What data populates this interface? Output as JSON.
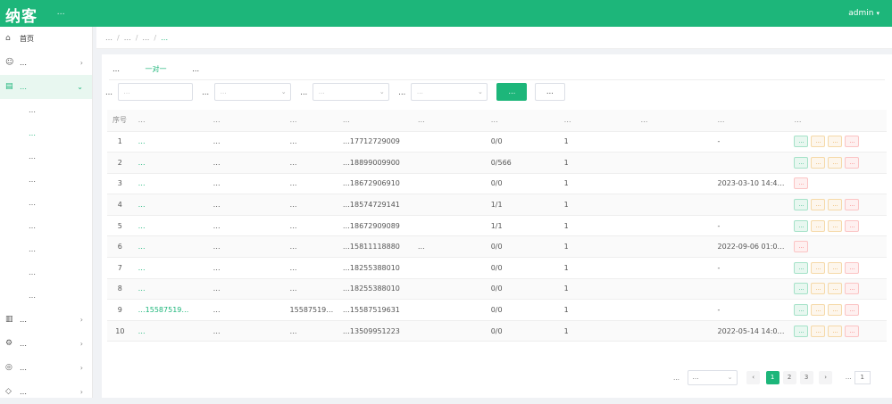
{
  "header": {
    "logo": "纳客",
    "slogan": "…",
    "user": "admin"
  },
  "sidebar": {
    "items": [
      {
        "label": "首页",
        "icon": "home-icon",
        "ico": "⌂"
      },
      {
        "label": "…",
        "icon": "user-icon",
        "ico": "☺"
      },
      {
        "label": "…",
        "icon": "book-icon",
        "ico": "▤"
      }
    ],
    "sub_items": [
      "…",
      "…",
      "…",
      "…",
      "…",
      "…",
      "…",
      "…",
      "…"
    ],
    "items_after": [
      {
        "label": "…",
        "icon": "clipboard-icon",
        "ico": "▥"
      },
      {
        "label": "…",
        "icon": "gear-icon",
        "ico": "⚙"
      },
      {
        "label": "…",
        "icon": "coin-icon",
        "ico": "◎"
      },
      {
        "label": "…",
        "icon": "shield-icon",
        "ico": "◇"
      }
    ]
  },
  "breadcrumb": [
    "…",
    "…",
    "…",
    "…"
  ],
  "tabs": [
    "…",
    "一对一",
    "…"
  ],
  "filters": {
    "label1": "…",
    "placeholder1": "…",
    "label2": "…",
    "placeholder2": "…",
    "label3": "…",
    "placeholder3": "…",
    "label4": "…",
    "placeholder4": "…",
    "query_label": "…",
    "reset_label": "…"
  },
  "table": {
    "headers": [
      "序号",
      "…",
      "…",
      "…",
      "…",
      "…",
      "…",
      "…",
      "…",
      "…",
      "…"
    ],
    "rows": [
      [
        "1",
        "…",
        "…",
        "…",
        "…17712729009",
        "",
        "0/0",
        "1",
        "",
        "-"
      ],
      [
        "2",
        "…",
        "…",
        "…",
        "…18899009900",
        "",
        "0/566",
        "1",
        "",
        ""
      ],
      [
        "3",
        "…",
        "…",
        "…",
        "…18672906910",
        "",
        "0/0",
        "1",
        "",
        "2023-03-10 14:49:…"
      ],
      [
        "4",
        "…",
        "…",
        "…",
        "…18574729141",
        "",
        "1/1",
        "1",
        "",
        ""
      ],
      [
        "5",
        "…",
        "…",
        "…",
        "…18672909089",
        "",
        "1/1",
        "1",
        "",
        "-"
      ],
      [
        "6",
        "…",
        "…",
        "…",
        "…15811118880",
        "…",
        "0/0",
        "1",
        "",
        "2022-09-06 01:00:…"
      ],
      [
        "7",
        "…",
        "…",
        "…",
        "…18255388010",
        "",
        "0/0",
        "1",
        "",
        "-"
      ],
      [
        "8",
        "…",
        "…",
        "…",
        "…18255388010",
        "",
        "0/0",
        "1",
        "",
        ""
      ],
      [
        "9",
        "…15587519…",
        "…",
        "15587519631",
        "…15587519631",
        "",
        "0/0",
        "1",
        "",
        "-"
      ],
      [
        "10",
        "…",
        "…",
        "…",
        "…13509951223",
        "",
        "0/0",
        "1",
        "",
        "2022-05-14 14:00:0…"
      ]
    ],
    "ops": [
      "…",
      "…",
      "…",
      "…"
    ]
  },
  "pagination": {
    "total": "…",
    "page_size": "…",
    "pages": [
      "1",
      "2",
      "3"
    ],
    "goto_label": "…",
    "goto_value": "1"
  }
}
